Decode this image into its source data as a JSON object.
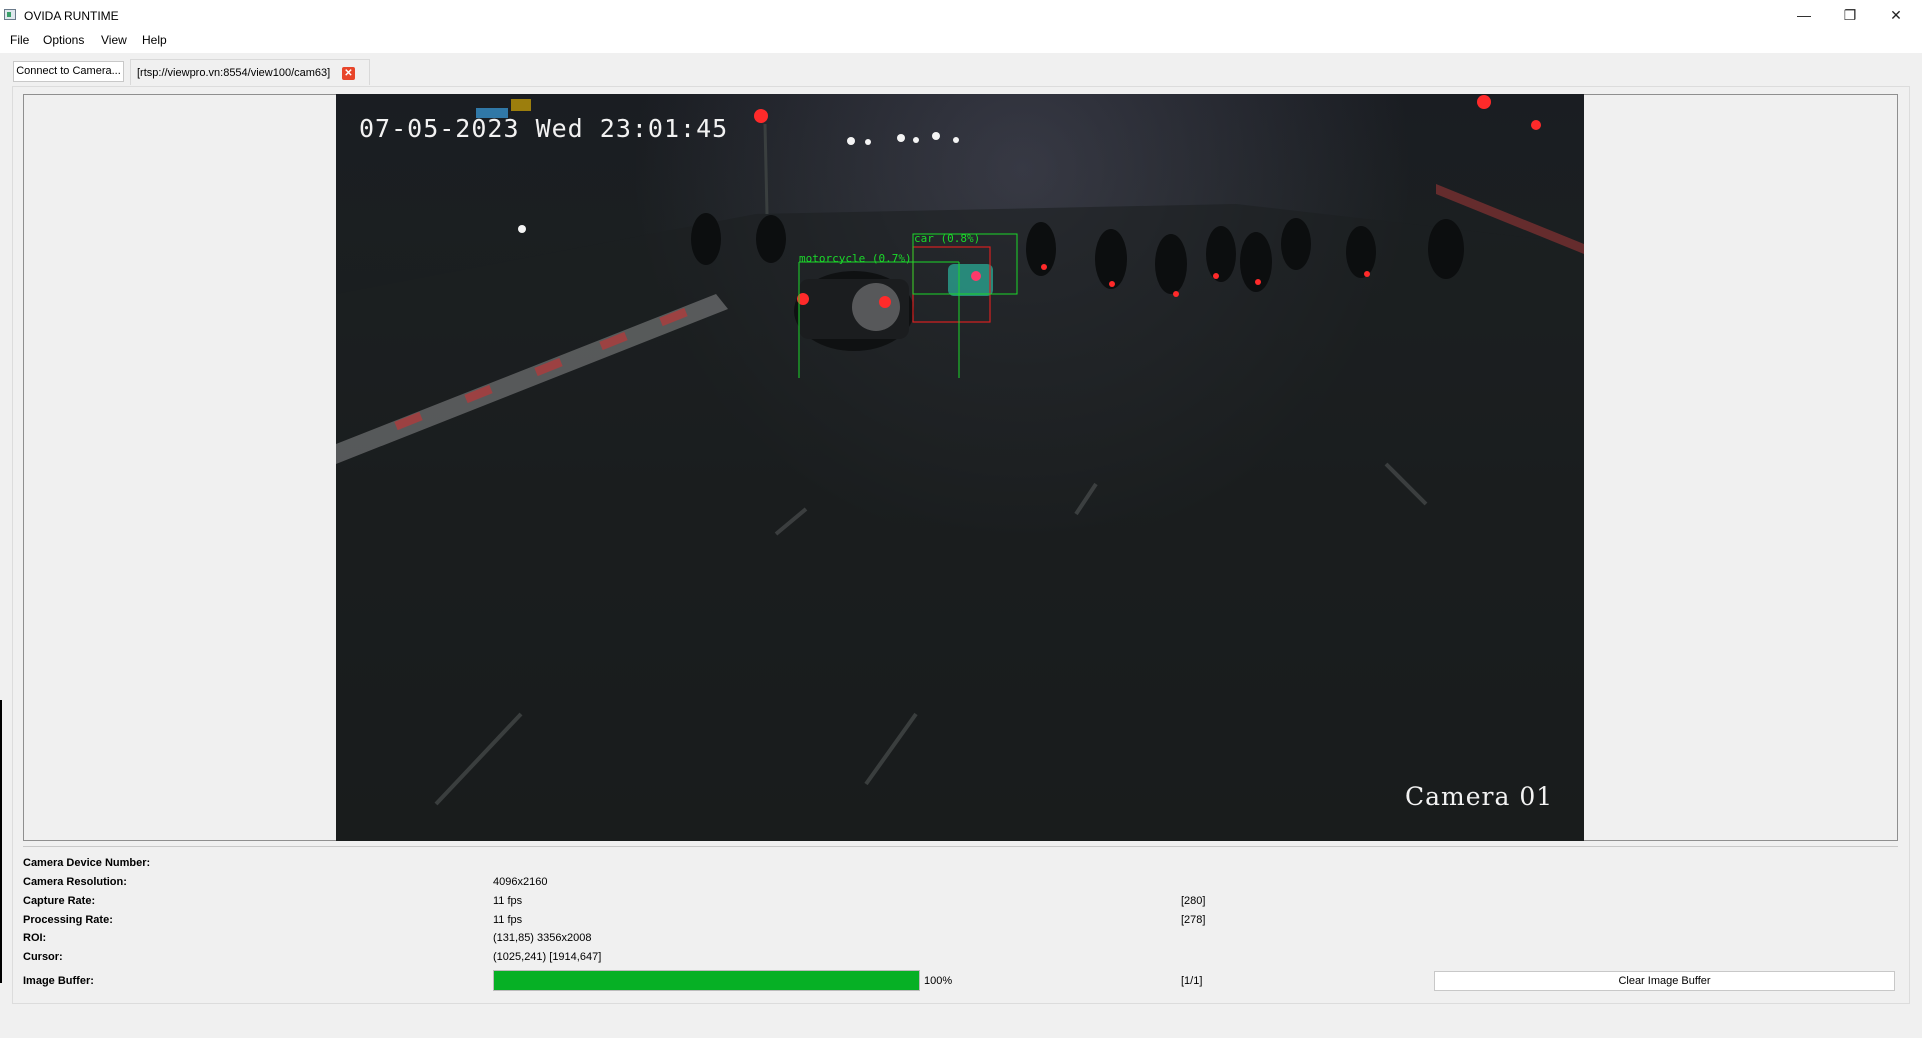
{
  "window": {
    "title": "OVIDA RUNTIME"
  },
  "menu": {
    "items": [
      "File",
      "Options",
      "View",
      "Help"
    ]
  },
  "toolbar": {
    "connect_label": "Connect to Camera...",
    "tab_label": "[rtsp://viewpro.vn:8554/view100/cam63]"
  },
  "video": {
    "timestamp": "07-05-2023 Wed 23:01:45",
    "camera_label": "Camera 01",
    "detections": [
      {
        "label": "car (0.8%)",
        "color": "#1bd82a"
      },
      {
        "label": "motorcycle (0.7%)",
        "color": "#1bd82a"
      }
    ]
  },
  "info": {
    "device_number_label": "Camera Device Number:",
    "device_number_value": "",
    "resolution_label": "Camera Resolution:",
    "resolution_value": "4096x2160",
    "capture_rate_label": "Capture Rate:",
    "capture_rate_value": "11 fps",
    "capture_rate_count": "[280]",
    "processing_rate_label": "Processing Rate:",
    "processing_rate_value": "11 fps",
    "processing_rate_count": "[278]",
    "roi_label": "ROI:",
    "roi_value": "(131,85) 3356x2008",
    "cursor_label": "Cursor:",
    "cursor_value": "(1025,241) [1914,647]",
    "buffer_label": "Image Buffer:",
    "buffer_percent_value": 100,
    "buffer_percent_text": "100%",
    "buffer_count": "[1/1]",
    "clear_buffer_label": "Clear Image Buffer"
  },
  "colors": {
    "progress": "#06b025",
    "tab_close": "#e8452a",
    "detection": "#1bd82a",
    "tail_light": "#ff2a2a"
  }
}
